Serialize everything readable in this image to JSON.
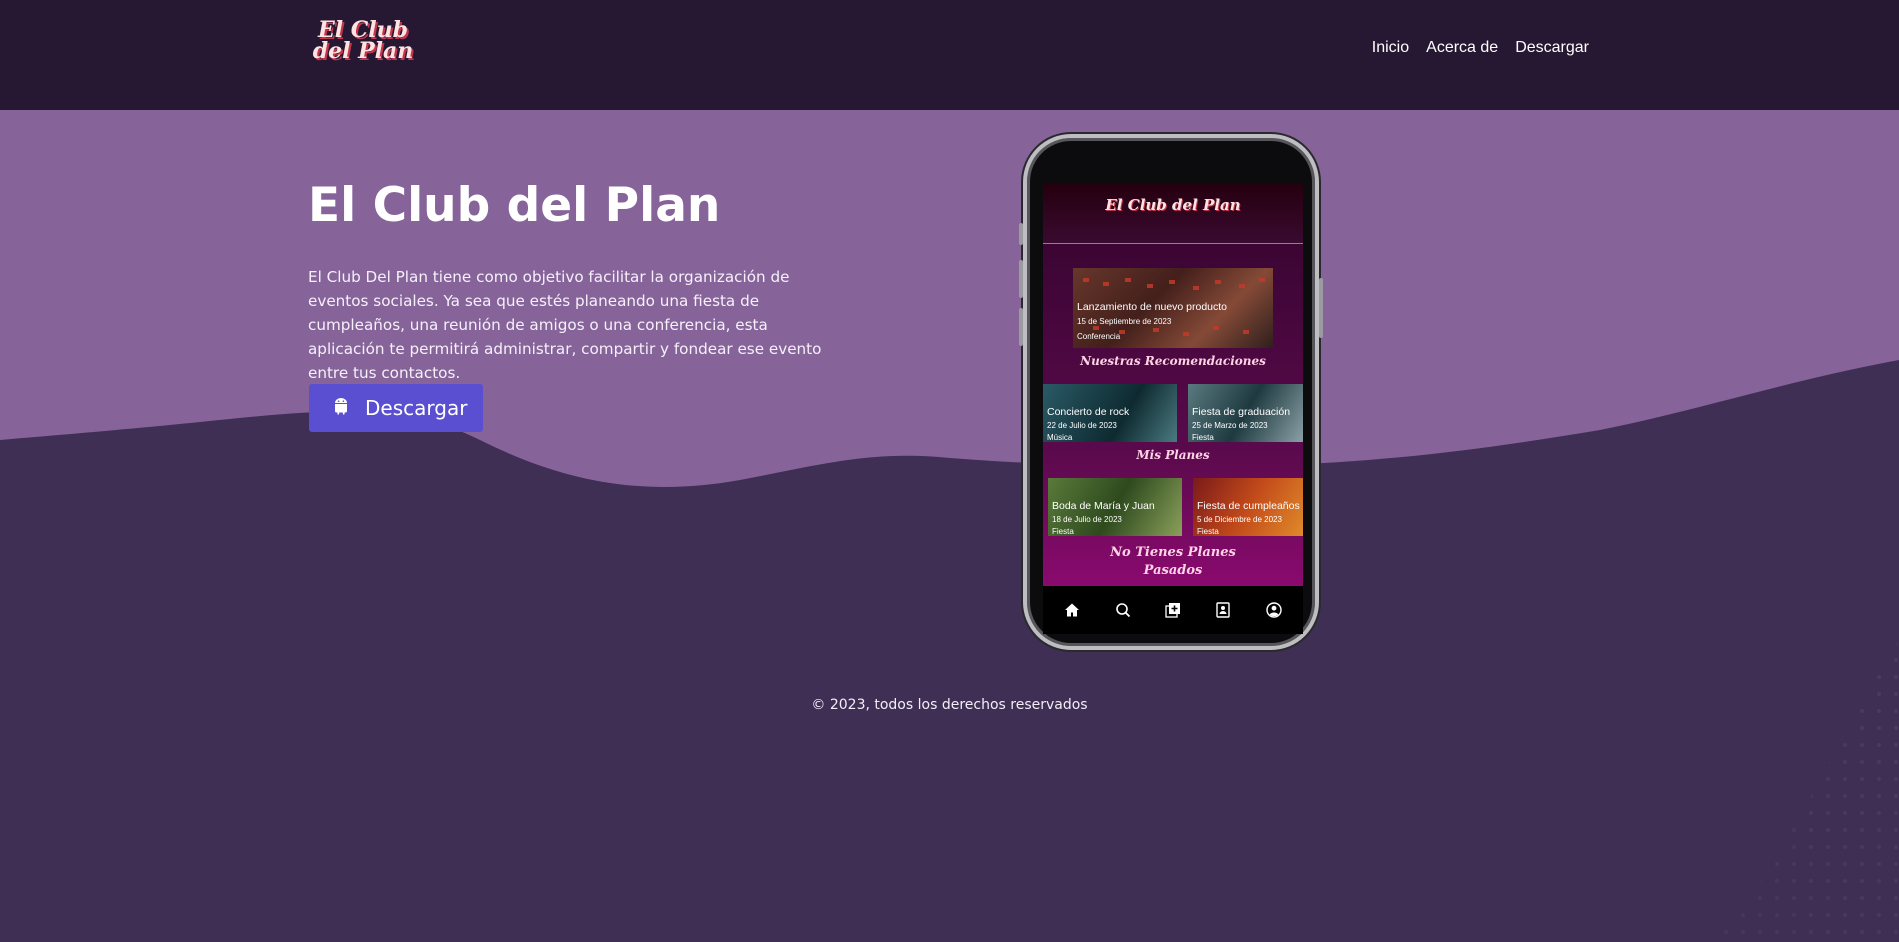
{
  "header": {
    "logo_text": "El Club del Plan",
    "nav": [
      "Inicio",
      "Acerca de",
      "Descargar"
    ]
  },
  "hero": {
    "title": "El Club del Plan",
    "description": "El Club Del Plan tiene como objetivo facilitar la organización de eventos sociales. Ya sea que estés planeando una fiesta de cumpleaños, una reunión de amigos o una conferencia, esta aplicación te permitirá administrar, compartir y fondear ese evento entre tus contactos.",
    "button_label": "Descargar",
    "button_icon": "android-icon"
  },
  "phone": {
    "app_logo": "El Club del Plan",
    "featured": {
      "title": "Lanzamiento de nuevo producto",
      "date": "15 de Septiembre de 2023",
      "category": "Conferencia"
    },
    "recommendations_title": "Nuestras Recomendaciones",
    "recommendations": [
      {
        "title": "Concierto de rock",
        "date": "22 de Julio de 2023",
        "category": "Música"
      },
      {
        "title": "Fiesta de graduación",
        "date": "25 de Marzo de 2023",
        "category": "Fiesta"
      }
    ],
    "my_plans_title": "Mis Planes",
    "my_plans": [
      {
        "title": "Boda de María y Juan",
        "date": "18 de Julio de 2023",
        "category": "Fiesta"
      },
      {
        "title": "Fiesta de cumpleaños",
        "date": "5 de Diciembre de 2023",
        "category": "Fiesta"
      }
    ],
    "past_plans_title": "No Tienes Planes Pasados",
    "tabbar_icons": [
      "home-icon",
      "search-icon",
      "add-icon",
      "contacts-icon",
      "profile-icon"
    ]
  },
  "footer": {
    "text": "© 2023, todos los derechos reservados"
  },
  "colors": {
    "header_bg": "#261833",
    "hero_bg": "#86649a",
    "page_bg": "#3f2f55",
    "button_bg": "#5a4fd0"
  }
}
